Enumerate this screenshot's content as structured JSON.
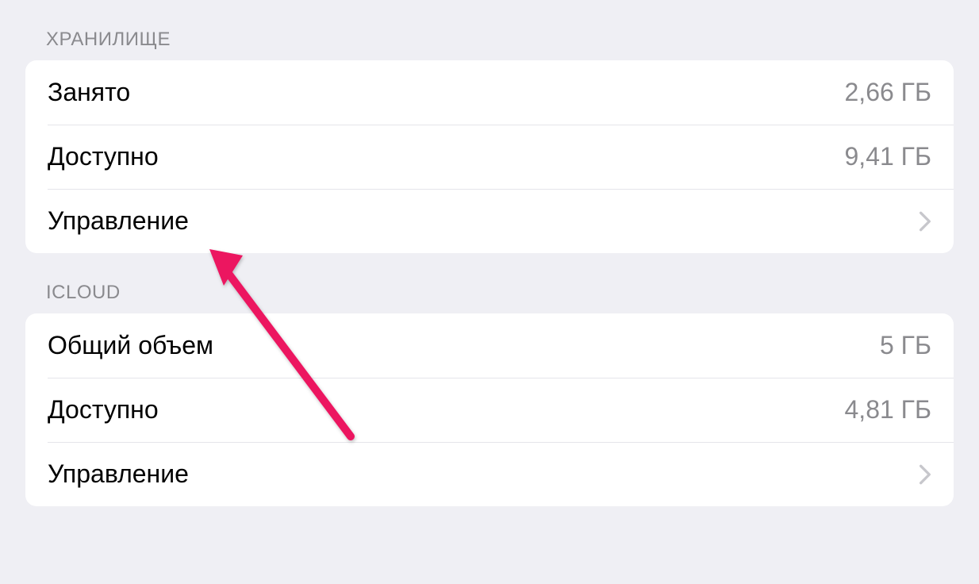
{
  "sections": {
    "storage": {
      "header": "ХРАНИЛИЩЕ",
      "rows": {
        "used": {
          "label": "Занято",
          "value": "2,66 ГБ"
        },
        "available": {
          "label": "Доступно",
          "value": "9,41 ГБ"
        },
        "manage": {
          "label": "Управление"
        }
      }
    },
    "icloud": {
      "header": "ICLOUD",
      "rows": {
        "total": {
          "label": "Общий объем",
          "value": "5 ГБ"
        },
        "available": {
          "label": "Доступно",
          "value": "4,81 ГБ"
        },
        "manage": {
          "label": "Управление"
        }
      }
    }
  },
  "colors": {
    "background": "#efeff4",
    "card": "#ffffff",
    "separator": "#e5e5ea",
    "label": "#000000",
    "value": "#8a8a8e",
    "arrow": "#ec1561"
  }
}
